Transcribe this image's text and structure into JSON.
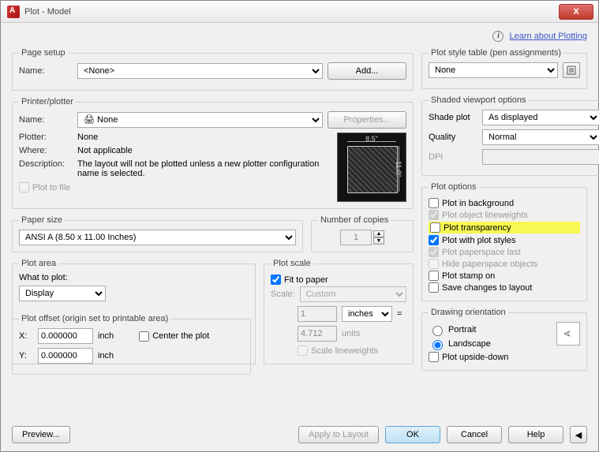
{
  "window": {
    "title": "Plot - Model",
    "close": "X"
  },
  "learn": {
    "link": "Learn about Plotting"
  },
  "pageSetup": {
    "legend": "Page setup",
    "nameLabel": "Name:",
    "nameValue": "<None>",
    "addBtn": "Add..."
  },
  "printer": {
    "legend": "Printer/plotter",
    "nameLabel": "Name:",
    "nameValue": "None",
    "propsBtn": "Properties...",
    "plotterLabel": "Plotter:",
    "plotterValue": "None",
    "whereLabel": "Where:",
    "whereValue": "Not applicable",
    "descLabel": "Description:",
    "descValue": "The layout will not be plotted unless a new plotter configuration name is selected.",
    "plotToFile": "Plot to file",
    "previewW": "8.5\"",
    "previewH": "11.0\""
  },
  "paperSize": {
    "legend": "Paper size",
    "value": "ANSI A (8.50 x 11.00 Inches)"
  },
  "copies": {
    "legend": "Number of copies",
    "value": "1"
  },
  "plotArea": {
    "legend": "Plot area",
    "whatLabel": "What to plot:",
    "whatValue": "Display"
  },
  "plotScale": {
    "legend": "Plot scale",
    "fit": "Fit to paper",
    "scaleLabel": "Scale:",
    "scaleValue": "Custom",
    "val1": "1",
    "unitSel": "inches",
    "eq": "=",
    "val2": "4.712",
    "unitsLabel": "units",
    "scaleLw": "Scale lineweights"
  },
  "plotOffset": {
    "legend": "Plot offset (origin set to printable area)",
    "xLabel": "X:",
    "xValue": "0.000000",
    "yLabel": "Y:",
    "yValue": "0.000000",
    "unit": "inch",
    "center": "Center the plot"
  },
  "plotStyle": {
    "legend": "Plot style table (pen assignments)",
    "value": "None"
  },
  "shaded": {
    "legend": "Shaded viewport options",
    "shadeLabel": "Shade plot",
    "shadeValue": "As displayed",
    "qualityLabel": "Quality",
    "qualityValue": "Normal",
    "dpiLabel": "DPI"
  },
  "plotOptions": {
    "legend": "Plot options",
    "bg": "Plot in background",
    "lw": "Plot object lineweights",
    "trans": "Plot transparency",
    "styles": "Plot with plot styles",
    "ps": "Plot paperspace last",
    "hide": "Hide paperspace objects",
    "stamp": "Plot stamp on",
    "save": "Save changes to layout"
  },
  "orientation": {
    "legend": "Drawing orientation",
    "portrait": "Portrait",
    "landscape": "Landscape",
    "upside": "Plot upside-down",
    "glyph": "A"
  },
  "footer": {
    "preview": "Preview...",
    "apply": "Apply to Layout",
    "ok": "OK",
    "cancel": "Cancel",
    "help": "Help"
  }
}
